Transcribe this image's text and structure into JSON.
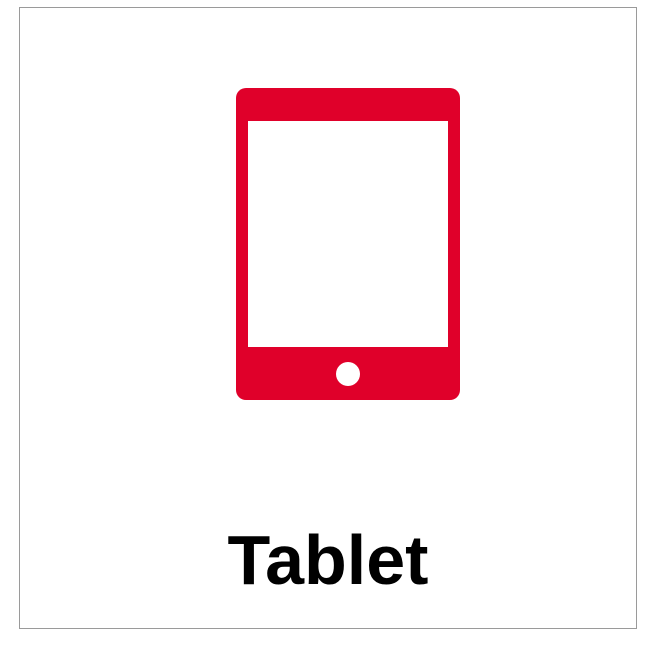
{
  "card": {
    "label": "Tablet",
    "icon": "tablet-icon",
    "colors": {
      "icon": "#e0002a",
      "screen": "#ffffff",
      "label": "#000000",
      "border": "#9a9a9a"
    }
  }
}
